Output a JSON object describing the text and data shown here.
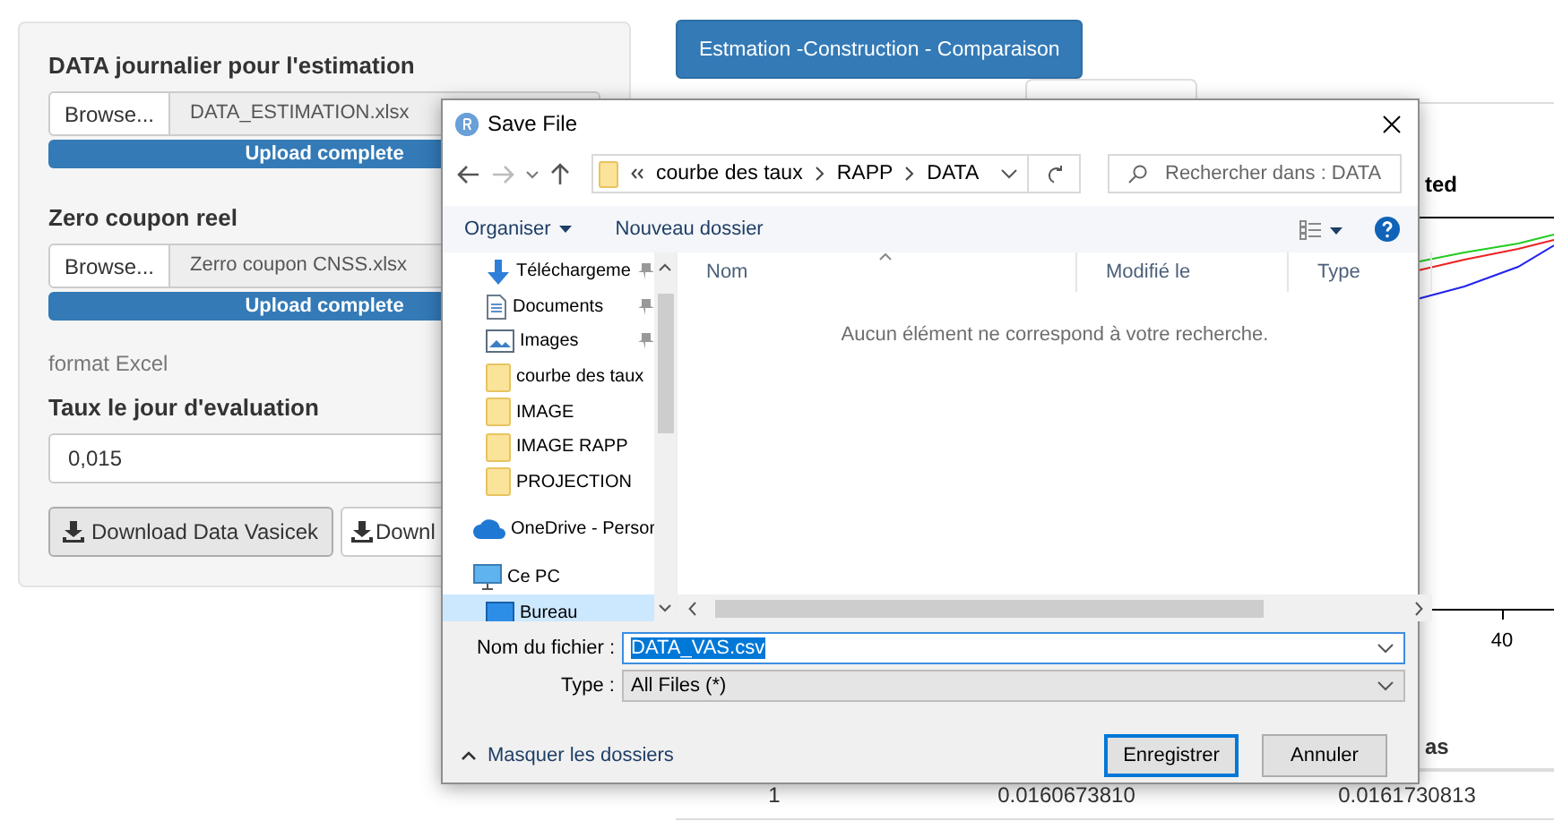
{
  "left_panel": {
    "uploads": [
      {
        "label": "DATA journalier pour l'estimation",
        "button": "Browse...",
        "file": "DATA_ESTIMATION.xlsx",
        "progress": "Upload complete",
        "level": 1
      },
      {
        "label": "Zero coupon reel",
        "button": "Browse...",
        "file": "Zerro coupon CNSS.xlsx",
        "progress": "Upload complete",
        "level": 1
      }
    ],
    "note": "format Excel",
    "rate": {
      "label": "Taux le jour d'evaluation",
      "value": "0,015"
    },
    "buttons": [
      {
        "label": "Download Data Vasicek",
        "active": true
      },
      {
        "label": "Downl",
        "active": false
      }
    ]
  },
  "main": {
    "action_button": "Estmation -Construction - Comparaison",
    "chart": {
      "title": "ted",
      "tick_label": "40"
    },
    "table": {
      "header": "as",
      "rows": [
        [
          "1",
          "0.0160673810",
          "0.0161730813"
        ]
      ]
    }
  },
  "dialog": {
    "title": "Save File",
    "path": [
      "courbe des taux",
      "RAPP",
      "DATA"
    ],
    "search_placeholder": "Rechercher dans : DATA",
    "toolbar": [
      {
        "label": "Organiser",
        "menu": true
      },
      {
        "label": "Nouveau dossier",
        "menu": false
      }
    ],
    "nav_pane": {
      "quick_access": [
        {
          "label": "Téléchargeme",
          "kind": "download",
          "pinned": true,
          "selected": false
        },
        {
          "label": "Documents",
          "kind": "document",
          "pinned": true,
          "selected": false
        },
        {
          "label": "Images",
          "kind": "picture",
          "pinned": true,
          "selected": false
        },
        {
          "label": "courbe des taux",
          "kind": "folder",
          "pinned": false,
          "selected": false
        },
        {
          "label": "IMAGE",
          "kind": "folder",
          "pinned": false,
          "selected": false
        },
        {
          "label": "IMAGE RAPP",
          "kind": "folder",
          "pinned": false,
          "selected": false
        },
        {
          "label": "PROJECTION",
          "kind": "folder",
          "pinned": false,
          "selected": false
        }
      ],
      "locations": [
        {
          "label": "OneDrive - Persor",
          "kind": "cloud",
          "selected": false
        },
        {
          "label": "Ce PC",
          "kind": "pc",
          "selected": false,
          "children": [
            {
              "label": "Bureau",
              "kind": "desktop",
              "selected": true
            }
          ]
        }
      ]
    },
    "columns": [
      "Nom",
      "Modifié le",
      "Type"
    ],
    "empty_message": "Aucun élément ne correspond à votre recherche.",
    "filename": {
      "label": "Nom du fichier :",
      "value": "DATA_VAS.csv",
      "text_selected": true
    },
    "filetype": {
      "label": "Type :",
      "value": "All Files  (*)"
    },
    "hide_folders": "Masquer les dossiers",
    "buttons": [
      {
        "label": "Enregistrer",
        "default": true
      },
      {
        "label": "Annuler",
        "default": false
      }
    ]
  }
}
